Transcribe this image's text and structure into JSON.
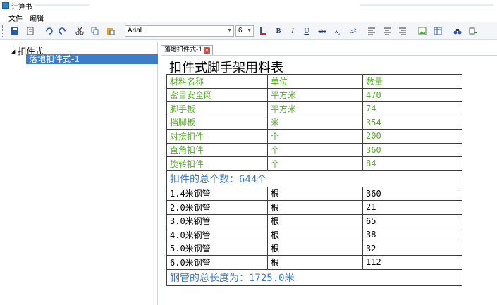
{
  "window": {
    "title": "计算书"
  },
  "menu": {
    "file": "文件",
    "edit": "编辑"
  },
  "toolbar": {
    "font_name": "Arial",
    "font_size": "6",
    "bold_label": "B",
    "italic_label": "I",
    "underline_label": "U",
    "strike_label": "abc",
    "subscript_label": "x₂",
    "superscript_label": "x²"
  },
  "tree": {
    "root_label": "扣件式",
    "child_label": "落地扣件式-1"
  },
  "document": {
    "tab_label": "落地扣件式-1",
    "title": "扣件式脚手架用料表",
    "headers": [
      "材料名称",
      "单位",
      "数量"
    ],
    "fastener_rows": [
      {
        "name": "密目安全网",
        "unit": "平方米",
        "qty": "470"
      },
      {
        "name": "脚手板",
        "unit": "平方米",
        "qty": "74"
      },
      {
        "name": "挡脚板",
        "unit": "米",
        "qty": "354"
      },
      {
        "name": "对接扣件",
        "unit": "个",
        "qty": "200"
      },
      {
        "name": "直角扣件",
        "unit": "个",
        "qty": "360"
      },
      {
        "name": "旋转扣件",
        "unit": "个",
        "qty": "84"
      }
    ],
    "fastener_total": "扣件的总个数：644个",
    "pipe_rows": [
      {
        "name": "1.4米钢管",
        "unit": "根",
        "qty": "360"
      },
      {
        "name": "2.0米钢管",
        "unit": "根",
        "qty": "21"
      },
      {
        "name": "3.0米钢管",
        "unit": "根",
        "qty": "65"
      },
      {
        "name": "4.0米钢管",
        "unit": "根",
        "qty": "38"
      },
      {
        "name": "5.0米钢管",
        "unit": "根",
        "qty": "32"
      },
      {
        "name": "6.0米钢管",
        "unit": "根",
        "qty": "112"
      }
    ],
    "pipe_total": "钢管的总长度为：1725.0米"
  },
  "colors": {
    "green_text": "#5ba832",
    "blue_text": "#3d7ec9",
    "selection": "#3d7ec9"
  }
}
